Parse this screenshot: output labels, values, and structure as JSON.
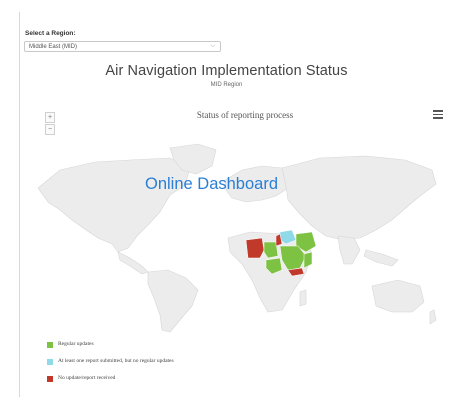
{
  "region_selector": {
    "label": "Select a Region:",
    "selected": "Middle East (MID)"
  },
  "header": {
    "title": "Air Navigation Implementation Status",
    "subtitle": "MID Region"
  },
  "map": {
    "title": "Status of reporting process",
    "zoom_in": "+",
    "zoom_out": "−",
    "menu_icon": "hamburger-menu-icon"
  },
  "watermark": "Online Dashboard",
  "legend": [
    {
      "label": "Regular updates",
      "color": "#7dc242"
    },
    {
      "label": "At least one report submitted, but no regular updates",
      "color": "#8fd9e8"
    },
    {
      "label": "No update/report received",
      "color": "#c0392b"
    }
  ]
}
